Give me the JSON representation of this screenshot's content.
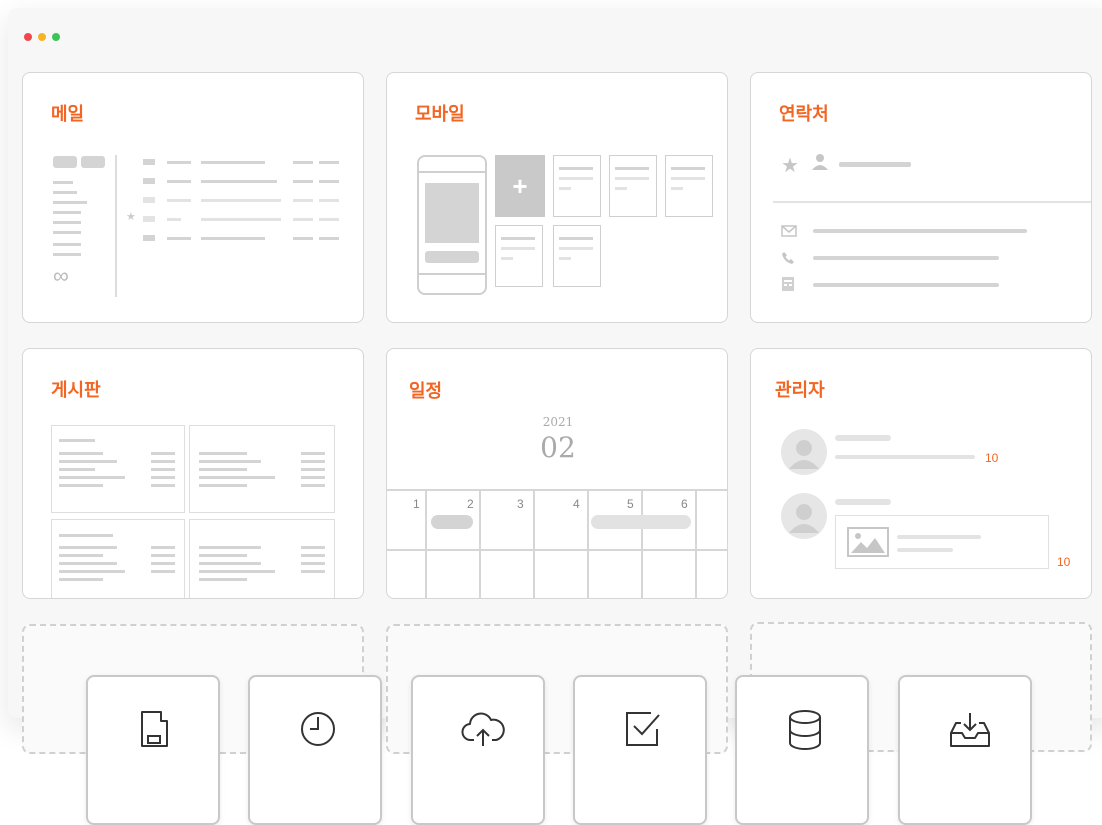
{
  "window": {
    "traffic_lights": [
      "#f0484a",
      "#f5b422",
      "#3cc457"
    ]
  },
  "cards": {
    "mail": {
      "title": "메일",
      "infinity": "∞"
    },
    "mobile": {
      "title": "모바일",
      "plus": "+"
    },
    "contacts": {
      "title": "연락처"
    },
    "board": {
      "title": "게시판"
    },
    "calendar": {
      "title": "일정",
      "year": "2021",
      "month": "02",
      "days": [
        "1",
        "2",
        "3",
        "4",
        "5",
        "6"
      ]
    },
    "admin": {
      "title": "관리자",
      "count1": "10",
      "count2": "10"
    }
  },
  "toolbar": {
    "icons": [
      "sd-card-icon",
      "clock-icon",
      "cloud-upload-icon",
      "checkbox-icon",
      "database-icon",
      "inbox-download-icon"
    ]
  },
  "colors": {
    "accent": "#f26522",
    "placeholder": "#d4d4d4"
  }
}
